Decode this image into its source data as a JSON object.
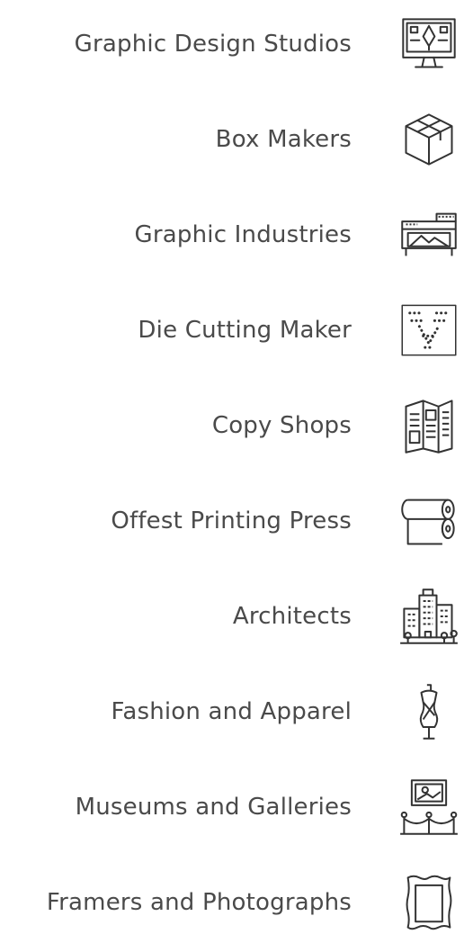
{
  "industries": [
    {
      "label": "Graphic Design Studios",
      "icon": "design-monitor-icon"
    },
    {
      "label": "Box Makers",
      "icon": "box-icon"
    },
    {
      "label": "Graphic Industries",
      "icon": "large-format-printer-icon"
    },
    {
      "label": "Die Cutting Maker",
      "icon": "die-cut-icon"
    },
    {
      "label": "Copy Shops",
      "icon": "brochure-icon"
    },
    {
      "label": "Offest Printing Press",
      "icon": "paper-roll-icon"
    },
    {
      "label": "Architects",
      "icon": "buildings-icon"
    },
    {
      "label": "Fashion and Apparel",
      "icon": "dress-form-icon"
    },
    {
      "label": "Museums and Galleries",
      "icon": "gallery-frame-icon"
    },
    {
      "label": "Framers and Photographs",
      "icon": "photo-frame-icon"
    }
  ],
  "colors": {
    "text": "#4a4a4a",
    "icon": "#333333",
    "background": "#ffffff"
  }
}
